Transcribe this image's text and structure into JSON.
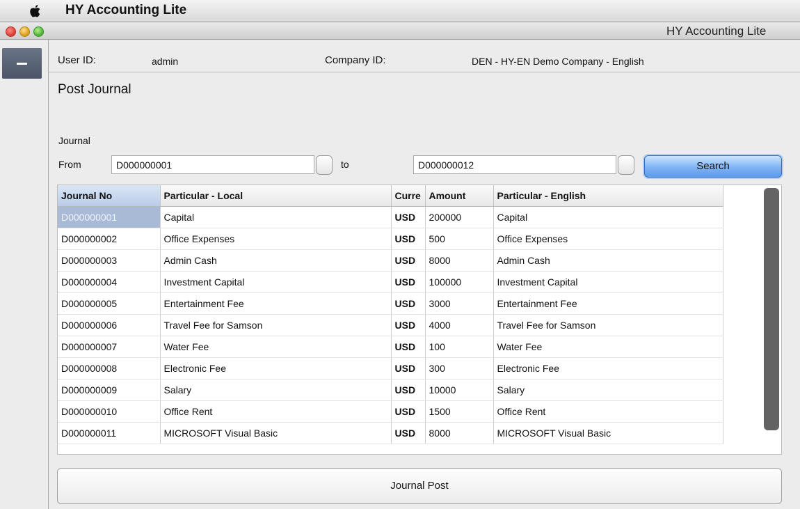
{
  "menubar": {
    "app_name": "HY Accounting Lite"
  },
  "window": {
    "title": "HY Accounting Lite"
  },
  "info": {
    "user_id_label": "User ID:",
    "user_id_value": "admin",
    "company_id_label": "Company ID:",
    "company_id_value": "DEN - HY-EN Demo Company - English"
  },
  "page": {
    "title": "Post Journal",
    "journal_label": "Journal",
    "from_label": "From",
    "from_value": "D000000001",
    "to_label": "to",
    "to_value": "D000000012",
    "search_label": "Search",
    "post_label": "Journal Post"
  },
  "table": {
    "columns": [
      "Journal No",
      "Particular - Local",
      "Currency",
      "Amount",
      "Particular - English"
    ],
    "column_display": [
      "Journal No",
      "Particular - Local",
      "Curre",
      "Amount",
      "Particular - English"
    ],
    "selected_row": 0,
    "rows": [
      {
        "no": "D000000001",
        "local": "Capital",
        "cur": "USD",
        "amount": "200000",
        "english": "Capital"
      },
      {
        "no": "D000000002",
        "local": "Office Expenses",
        "cur": "USD",
        "amount": "500",
        "english": "Office Expenses"
      },
      {
        "no": "D000000003",
        "local": "Admin Cash",
        "cur": "USD",
        "amount": "8000",
        "english": "Admin Cash"
      },
      {
        "no": "D000000004",
        "local": "Investment Capital",
        "cur": "USD",
        "amount": "100000",
        "english": "Investment Capital"
      },
      {
        "no": "D000000005",
        "local": "Entertainment Fee",
        "cur": "USD",
        "amount": "3000",
        "english": "Entertainment Fee"
      },
      {
        "no": "D000000006",
        "local": "Travel Fee for Samson",
        "cur": "USD",
        "amount": "4000",
        "english": "Travel Fee for Samson"
      },
      {
        "no": "D000000007",
        "local": "Water Fee",
        "cur": "USD",
        "amount": "100",
        "english": "Water Fee"
      },
      {
        "no": "D000000008",
        "local": "Electronic Fee",
        "cur": "USD",
        "amount": "300",
        "english": "Electronic Fee"
      },
      {
        "no": "D000000009",
        "local": "Salary",
        "cur": "USD",
        "amount": "10000",
        "english": "Salary"
      },
      {
        "no": "D000000010",
        "local": "Office Rent",
        "cur": "USD",
        "amount": "1500",
        "english": "Office Rent"
      },
      {
        "no": "D000000011",
        "local": "MICROSOFT Visual Basic",
        "cur": "USD",
        "amount": "8000",
        "english": "MICROSOFT Visual Basic"
      }
    ]
  },
  "colors": {
    "selection": "#a9bad6",
    "search_button": "#7fb3f4",
    "collapse_button": "#56607a"
  },
  "icons": {
    "apple": "apple-logo-icon",
    "collapse": "minus-icon"
  }
}
